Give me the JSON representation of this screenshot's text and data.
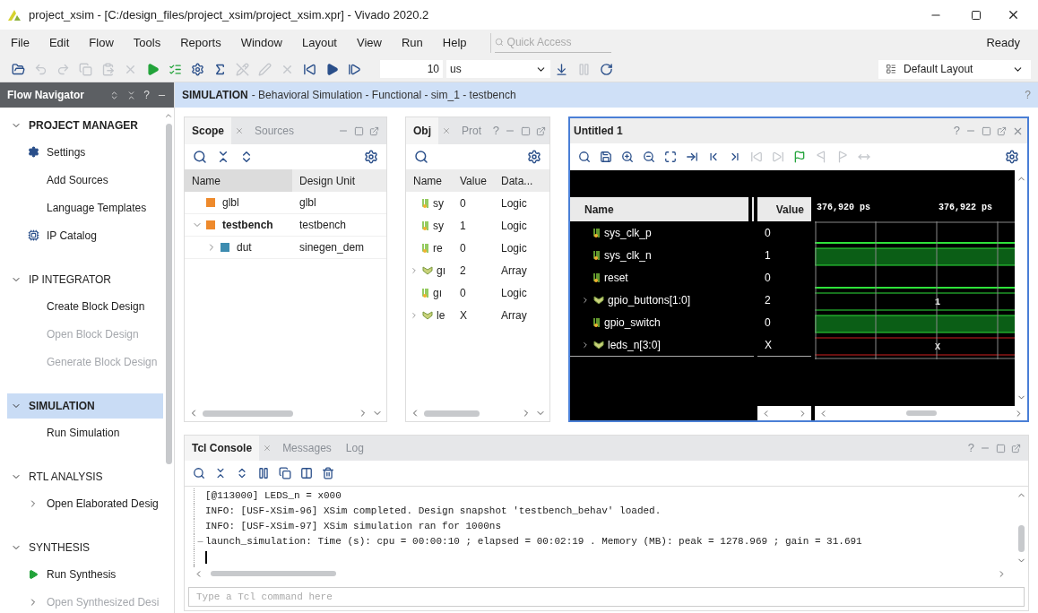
{
  "window": {
    "title": "project_xsim - [C:/design_files/project_xsim/project_xsim.xpr] - Vivado 2020.2"
  },
  "menu": [
    "File",
    "Edit",
    "Flow",
    "Tools",
    "Reports",
    "Window",
    "Layout",
    "View",
    "Run",
    "Help"
  ],
  "quick_access": {
    "placeholder": "Quick Access"
  },
  "status": "Ready",
  "toolbar": [
    {
      "kind": "open",
      "disabled": false
    },
    {
      "kind": "undo",
      "disabled": true
    },
    {
      "kind": "redo",
      "disabled": true
    },
    {
      "kind": "copy",
      "disabled": true
    },
    {
      "kind": "paste",
      "disabled": true
    },
    {
      "kind": "delete",
      "disabled": true
    },
    {
      "kind": "run",
      "disabled": false
    },
    {
      "kind": "program",
      "disabled": false
    },
    {
      "kind": "gear",
      "disabled": false
    },
    {
      "kind": "sigma",
      "disabled": false
    },
    {
      "kind": "edit",
      "disabled": true
    },
    {
      "kind": "pen",
      "disabled": true
    },
    {
      "kind": "delete",
      "disabled": true
    },
    {
      "kind": "restart",
      "disabled": false
    },
    {
      "kind": "play",
      "disabled": false
    },
    {
      "kind": "step",
      "disabled": false
    }
  ],
  "run_time": {
    "value": "10",
    "unit": "us"
  },
  "toolbar_after": [
    {
      "kind": "download",
      "disabled": false
    },
    {
      "kind": "pause",
      "disabled": true
    },
    {
      "kind": "reload",
      "disabled": false
    }
  ],
  "layout_select": "Default Layout",
  "flow_navigator": {
    "title": "Flow Navigator",
    "help": "?",
    "sections": [
      {
        "label": "PROJECT MANAGER",
        "expanded": true,
        "selected": false,
        "items": [
          {
            "label": "Settings",
            "kind": "gear",
            "disabled": false
          },
          {
            "label": "Add Sources",
            "kind": "plain",
            "disabled": false
          },
          {
            "label": "Language Templates",
            "kind": "plain",
            "disabled": false
          },
          {
            "label": "IP Catalog",
            "kind": "ip",
            "disabled": false
          }
        ]
      },
      {
        "label": "IP INTEGRATOR",
        "expanded": true,
        "selected": false,
        "items": [
          {
            "label": "Create Block Design",
            "kind": "plain",
            "disabled": false
          },
          {
            "label": "Open Block Design",
            "kind": "plain",
            "disabled": true
          },
          {
            "label": "Generate Block Design",
            "kind": "plain",
            "disabled": true
          }
        ]
      },
      {
        "label": "SIMULATION",
        "expanded": true,
        "selected": true,
        "items": [
          {
            "label": "Run Simulation",
            "kind": "plain",
            "disabled": false
          }
        ]
      },
      {
        "label": "RTL ANALYSIS",
        "expanded": true,
        "selected": false,
        "items": [
          {
            "label": "Open Elaborated Desig",
            "kind": "expand",
            "disabled": false
          }
        ]
      },
      {
        "label": "SYNTHESIS",
        "expanded": true,
        "selected": false,
        "items": [
          {
            "label": "Run Synthesis",
            "kind": "play",
            "disabled": false
          },
          {
            "label": "Open Synthesized Desi",
            "kind": "expand",
            "disabled": true
          }
        ]
      }
    ]
  },
  "sim_header": {
    "title": "SIMULATION",
    "subtitle": "- Behavioral Simulation - Functional - sim_1 - testbench",
    "help": "?"
  },
  "scope_panel": {
    "tabs": [
      {
        "label": "Scope",
        "selected": true
      },
      {
        "label": "Sources",
        "selected": false
      }
    ],
    "columns": [
      "Name",
      "Design Unit"
    ],
    "rows": [
      {
        "name": "glbl",
        "unit": "glbl",
        "color": "#ee8a2c",
        "top": false
      },
      {
        "name": "testbench",
        "unit": "testbench",
        "color": "#ee8a2c",
        "top": true,
        "expanded": true,
        "children": [
          {
            "name": "dut",
            "unit": "sinegen_dem",
            "color": "#3d8cb0",
            "top": false,
            "expanded": false
          }
        ]
      }
    ]
  },
  "objects_panel": {
    "tabs": [
      {
        "label": "Obj",
        "selected": true
      },
      {
        "label": "Prot",
        "selected": false
      }
    ],
    "help": "?",
    "columns": [
      "Name",
      "Value",
      "Data..."
    ],
    "rows": [
      {
        "name": "sy",
        "value": "0",
        "type": "Logic",
        "kind": "bit"
      },
      {
        "name": "sy",
        "value": "1",
        "type": "Logic",
        "kind": "bit"
      },
      {
        "name": "re",
        "value": "0",
        "type": "Logic",
        "kind": "bit"
      },
      {
        "name": "gı",
        "value": "2",
        "type": "Array",
        "kind": "bus"
      },
      {
        "name": "gı",
        "value": "0",
        "type": "Logic",
        "kind": "bit"
      },
      {
        "name": "le",
        "value": "X",
        "type": "Array",
        "kind": "bus"
      }
    ]
  },
  "wave_panel": {
    "title": "Untitled 1",
    "help": "?",
    "columns": [
      "Name",
      "Value"
    ],
    "time_labels": [
      "376,920 ps",
      "376,922 ps"
    ],
    "toolbar": [
      {
        "kind": "search",
        "disabled": false
      },
      {
        "kind": "save",
        "disabled": false
      },
      {
        "kind": "zoom-in",
        "disabled": false
      },
      {
        "kind": "zoom-out",
        "disabled": false
      },
      {
        "kind": "fit",
        "disabled": false
      },
      {
        "kind": "cursor",
        "disabled": false
      },
      {
        "kind": "prev",
        "disabled": false
      },
      {
        "kind": "next",
        "disabled": false
      },
      {
        "kind": "prev-edge",
        "disabled": true
      },
      {
        "kind": "next-edge",
        "disabled": true
      },
      {
        "kind": "marker",
        "disabled": false
      },
      {
        "kind": "marker-prev",
        "disabled": true
      },
      {
        "kind": "marker-next",
        "disabled": true
      },
      {
        "kind": "swap",
        "disabled": true
      }
    ],
    "signals": [
      {
        "name": "sys_clk_p",
        "value": "0",
        "kind": "bit",
        "high": false
      },
      {
        "name": "sys_clk_n",
        "value": "1",
        "kind": "bit",
        "high": true
      },
      {
        "name": "reset",
        "value": "0",
        "kind": "bit",
        "high": false
      },
      {
        "name": "gpio_buttons[1:0]",
        "value": "2",
        "kind": "bus",
        "unknown": false,
        "bus_label": "1"
      },
      {
        "name": "gpio_switch",
        "value": "0",
        "kind": "bit",
        "high": true
      },
      {
        "name": "leds_n[3:0]",
        "value": "X",
        "kind": "bus",
        "unknown": true,
        "bus_label": "X"
      }
    ]
  },
  "console": {
    "tabs": [
      {
        "label": "Tcl Console",
        "selected": true
      },
      {
        "label": "Messages",
        "selected": false
      },
      {
        "label": "Log",
        "selected": false
      }
    ],
    "help": "?",
    "toolbar": [
      {
        "kind": "search",
        "disabled": false
      },
      {
        "kind": "collapse",
        "disabled": false
      },
      {
        "kind": "expand",
        "disabled": false
      },
      {
        "kind": "pause",
        "disabled": false
      },
      {
        "kind": "copy",
        "disabled": false
      },
      {
        "kind": "columns",
        "disabled": false
      },
      {
        "kind": "trash",
        "disabled": false
      }
    ],
    "lines": [
      {
        "text": "[@113000] LEDS_n = x000",
        "fold": false
      },
      {
        "text": "INFO: [USF-XSim-96] XSim completed. Design snapshot 'testbench_behav' loaded.",
        "fold": false
      },
      {
        "text": "INFO: [USF-XSim-97] XSim simulation ran for 1000ns",
        "fold": false
      },
      {
        "text": "launch_simulation: Time (s): cpu = 00:00:10 ; elapsed = 00:02:19 . Memory (MB): peak = 1278.969 ; gain = 31.691",
        "fold": true
      }
    ],
    "input": {
      "placeholder": "Type a Tcl command here"
    }
  }
}
